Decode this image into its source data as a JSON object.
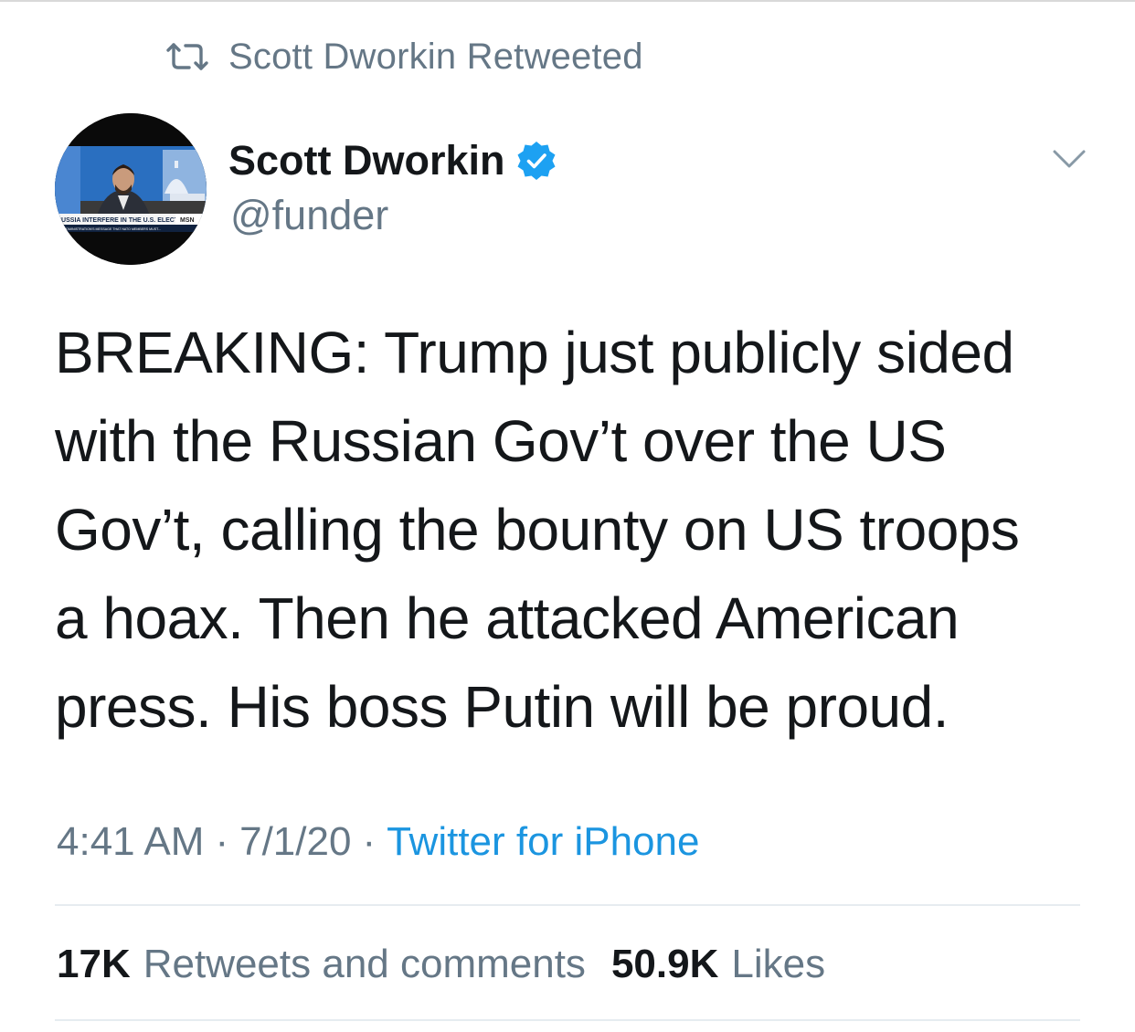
{
  "social_context": {
    "icon": "retweet-icon",
    "text": "Scott Dworkin Retweeted"
  },
  "author": {
    "display_name": "Scott Dworkin",
    "handle": "@funder",
    "verified": true,
    "avatar": {
      "ticker_line1": "RUSSIA INTERFERE IN THE U.S. ELECTION?",
      "network": "MSN",
      "ticker_line2": "ADMINISTRATION'S MESSAGE THAT NATO MEMBERS MUST..."
    }
  },
  "tweet": {
    "text": "BREAKING: Trump just publicly sided\nwith the Russian Gov’t over the US\nGov’t, calling the bounty on US troops\na hoax. Then he attacked American\npress. His boss Putin will be proud."
  },
  "meta": {
    "time": "4:41 AM",
    "separator": "·",
    "date": "7/1/20",
    "source": "Twitter for iPhone"
  },
  "stats": {
    "retweets_count": "17K",
    "retweets_label": "Retweets and comments",
    "likes_count": "50.9K",
    "likes_label": "Likes"
  },
  "colors": {
    "text_primary": "#14171a",
    "text_secondary": "#657786",
    "link": "#1b95e0",
    "verified_blue": "#1da1f2",
    "divider": "#e6ecf0"
  }
}
